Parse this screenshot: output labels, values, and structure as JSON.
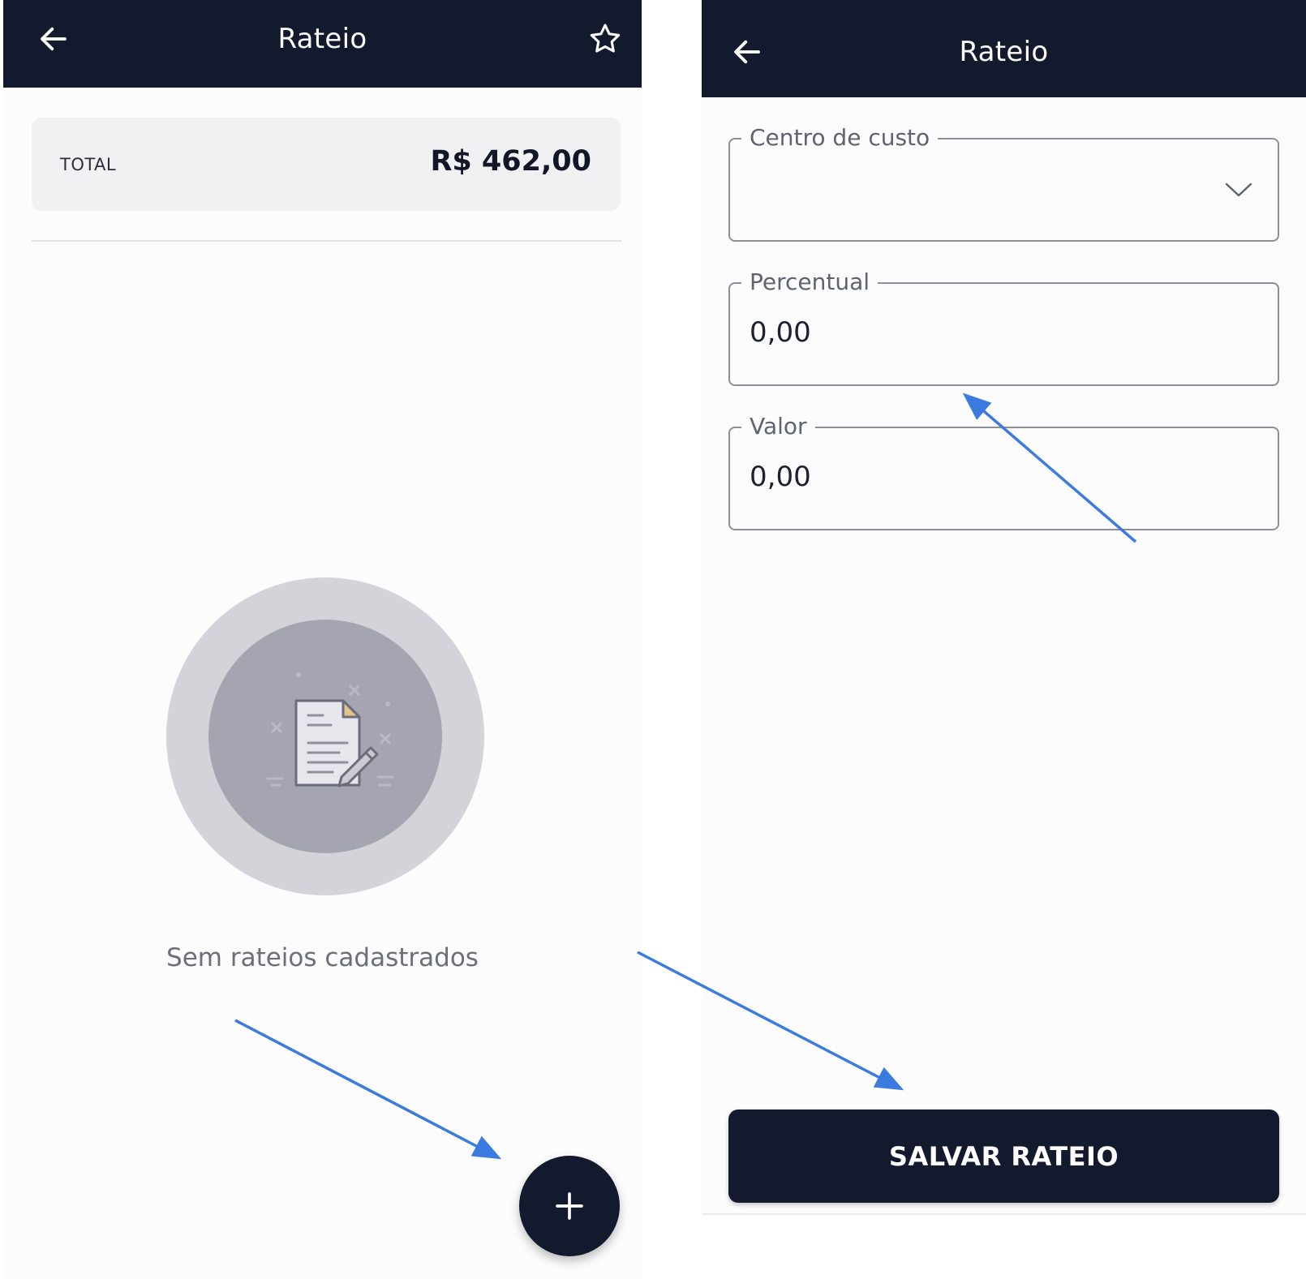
{
  "left_screen": {
    "title": "Rateio",
    "total_label": "TOTAL",
    "total_value": "R$ 462,00",
    "empty_message": "Sem rateios cadastrados",
    "icons": {
      "back": "arrow-left-icon",
      "favorite": "star-outline-icon",
      "empty": "document-edit-icon",
      "add": "plus-icon"
    }
  },
  "right_screen": {
    "title": "Rateio",
    "fields": {
      "centro_de_custo": {
        "label": "Centro de custo",
        "value": ""
      },
      "percentual": {
        "label": "Percentual",
        "value": "0,00"
      },
      "valor": {
        "label": "Valor",
        "value": "0,00"
      }
    },
    "save_button_label": "SALVAR RATEIO",
    "icons": {
      "back": "arrow-left-icon",
      "dropdown": "chevron-down-icon"
    }
  },
  "colors": {
    "appbar": "#131a2e",
    "card_background": "#f1f1f4",
    "annotation_arrow": "#3b7be0",
    "illustration_outer": "#d3d3d9",
    "illustration_inner": "#a4a5b1"
  }
}
